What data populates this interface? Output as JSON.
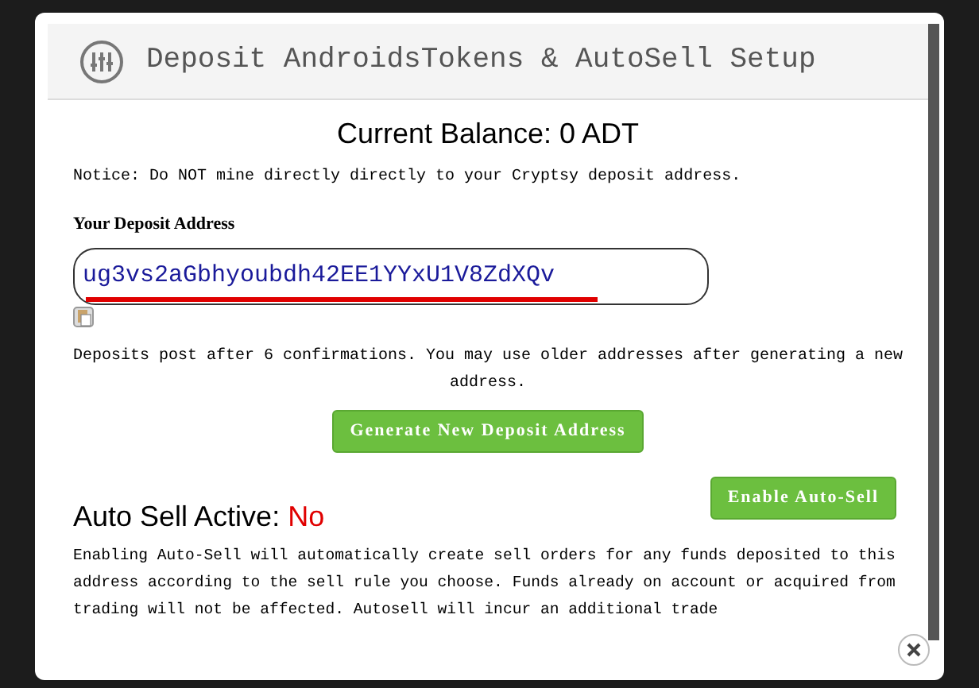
{
  "dialog": {
    "title": "Deposit AndroidsTokens & AutoSell Setup"
  },
  "balance": "Current Balance: 0 ADT",
  "notice": "Notice: Do NOT mine directly directly to your Cryptsy deposit address.",
  "address_label": "Your Deposit Address",
  "address_value": "ug3vs2aGbhyoubdh42EE1YYxU1V8ZdXQv",
  "deposit_info": "Deposits post after 6 confirmations. You may use older addresses after generating a new address.",
  "generate_button": "Generate New Deposit Address",
  "autosell": {
    "label": "Auto Sell Active:",
    "status": "No",
    "active": false,
    "button": "Enable Auto-Sell"
  },
  "autosell_info": "Enabling Auto-Sell will automatically create sell orders for any funds deposited to this address according to the sell rule you choose. Funds already on account or acquired from trading will not be affected. Autosell will incur an additional trade"
}
